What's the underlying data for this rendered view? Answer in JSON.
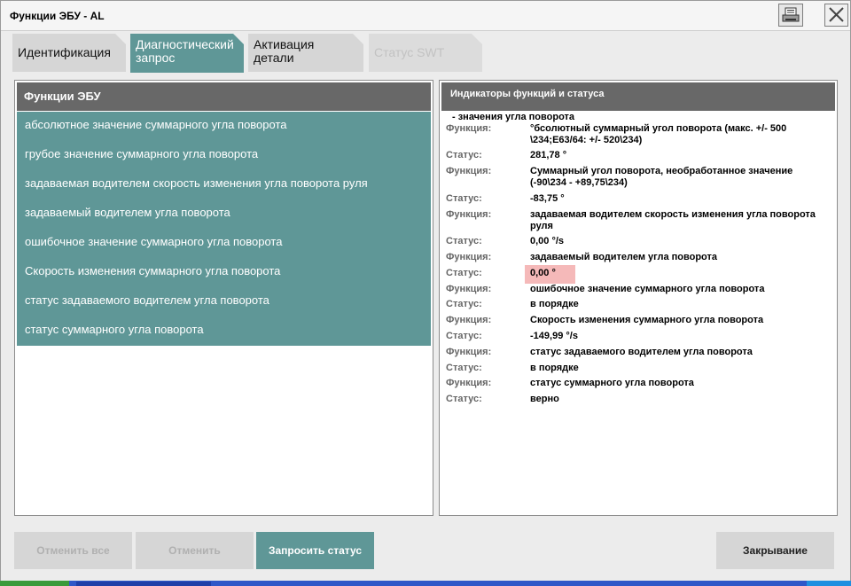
{
  "window": {
    "title": "Функции ЭБУ - AL"
  },
  "tabs": [
    {
      "label": "Идентификация",
      "state": "inactive"
    },
    {
      "label": "Диагностический запрос",
      "state": "active"
    },
    {
      "label": "Активация детали",
      "state": "inactive"
    },
    {
      "label": "Статус SWT",
      "state": "disabled"
    }
  ],
  "left_panel": {
    "header": "Функции ЭБУ",
    "items": [
      "абсолютное значение суммарного угла поворота",
      "грубое значение суммарного угла поворота",
      "задаваемая водителем скорость изменения угла поворота руля",
      "задаваемый водителем угла поворота",
      "ошибочное значение суммарного угла поворота",
      "Скорость изменения суммарного угла поворота",
      "статус задаваемого водителем угла поворота",
      "статус суммарного угла поворота"
    ]
  },
  "right_panel": {
    "header": "Индикаторы функций и статуса",
    "group_title": "- значения угла поворота",
    "rows": [
      {
        "label": "Функция:",
        "value": "°бсолютный суммарный угол поворота (макс. +/- 500 \\234;E63/64: +/- 520\\234)"
      },
      {
        "label": "Статус:",
        "value": "281,78 °"
      },
      {
        "label": "Функция:",
        "value": "Суммарный угол поворота, необработанное значение (-90\\234 - +89,75\\234)"
      },
      {
        "label": "Статус:",
        "value": "-83,75 °"
      },
      {
        "label": "Функция:",
        "value": "задаваемая водителем скорость изменения угла поворота руля"
      },
      {
        "label": "Статус:",
        "value": "0,00 °/s"
      },
      {
        "label": "Функция:",
        "value": "задаваемый водителем угла поворота"
      },
      {
        "label": "Статус:",
        "value": "0,00 °"
      },
      {
        "label": "Функция:",
        "value": "ошибочное значение суммарного угла поворота"
      },
      {
        "label": "Статус:",
        "value": "в порядке"
      },
      {
        "label": "Функция:",
        "value": "Скорость изменения суммарного угла поворота"
      },
      {
        "label": "Статус:",
        "value": "-149,99 °/s"
      },
      {
        "label": "Функция:",
        "value": "статус задаваемого водителем угла поворота"
      },
      {
        "label": "Статус:",
        "value": "в порядке"
      },
      {
        "label": "Функция:",
        "value": "статус суммарного угла поворота"
      },
      {
        "label": "Статус:",
        "value": "верно"
      }
    ]
  },
  "buttons": {
    "cancel_all": "Отменить все",
    "cancel": "Отменить",
    "request_status": "Запросить статус",
    "close": "Закрывание"
  },
  "colors": {
    "accent": "#5f9797",
    "header": "#686868",
    "highlight": "#f5b9b9"
  },
  "icons": {
    "print": "print-icon",
    "close": "close-icon"
  }
}
